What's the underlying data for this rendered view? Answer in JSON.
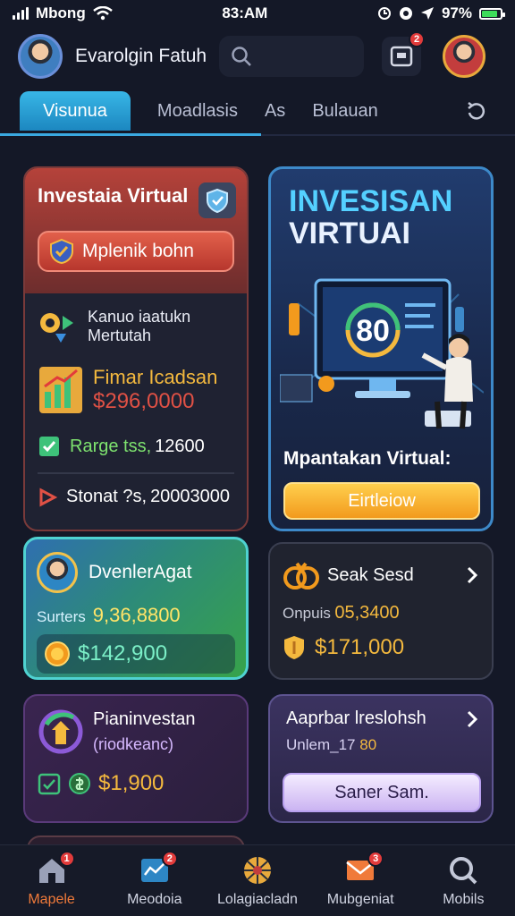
{
  "status_bar": {
    "carrier": "Mbong",
    "time": "83:AM",
    "battery": "97%"
  },
  "header": {
    "app_title": "Evarolgin Fatuh",
    "notification_count": "2"
  },
  "tabs": {
    "items": [
      "Visunua",
      "Moadlasis",
      "As",
      "Bulauan"
    ],
    "active": "Visunua"
  },
  "invest_card": {
    "title": "Investaia Virtual",
    "button_label": "Mplenik bohn",
    "rows": {
      "info_line1": "Kanuo iaatukn",
      "info_line2": "Mertutah",
      "fund_label": "Fimar Icadsan",
      "fund_value": "$296,0000",
      "range_label": "Rarge tss,",
      "range_value": "12600",
      "stonat_label": "Stonat ?s,",
      "stonat_value": "20003000"
    }
  },
  "hero_card": {
    "title_line1": "INVESISAN",
    "title_line2": "VIRTUAI",
    "screen_number": "80",
    "caption": "Mpantakan Virtual:",
    "button_label": "Eirtleiow"
  },
  "overview_card": {
    "title": "DvenlerAgat",
    "sub_label": "Surters",
    "sub_value": "9,36,8800",
    "balance": "$142,900"
  },
  "seak_card": {
    "title": "Seak Sesd",
    "sub_label": "Onpuis",
    "sub_value": "05,3400",
    "balance": "$171,000"
  },
  "plan_card": {
    "title": "Pianinvestan",
    "subtitle": "(riodkeanc)",
    "balance": "$1,900"
  },
  "apr_card": {
    "title": "Aaprbar lreslohsh",
    "sub_label": "Unlem_17",
    "sub_value": "80",
    "button_label": "Saner Sam."
  },
  "bottom_nav": {
    "items": [
      {
        "label": "Mapele",
        "badge": "1"
      },
      {
        "label": "Meodoia",
        "badge": "2"
      },
      {
        "label": "Lolagiacladn",
        "badge": ""
      },
      {
        "label": "Mubgeniat",
        "badge": "3"
      },
      {
        "label": "Mobils",
        "badge": ""
      }
    ],
    "active": "Mapele"
  },
  "colors": {
    "background": "#141827",
    "accent_blue": "#38b6e6",
    "gold": "#f4b93e",
    "red": "#e05145",
    "nav_active": "#f07a3a"
  }
}
